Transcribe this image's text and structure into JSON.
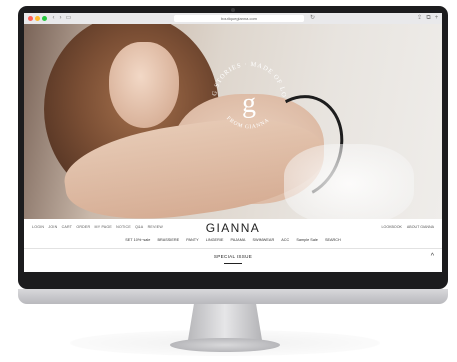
{
  "browser": {
    "url": "boutiquegianna.com"
  },
  "hero": {
    "logo_letter": "g",
    "logo_ring_text": "G STORIES · MADE OF LOVE",
    "logo_bottom_text": "FROM GIANNA"
  },
  "header": {
    "brand": "GIANNA",
    "top_links": [
      "LOGIN",
      "JOIN",
      "CART",
      "ORDER",
      "MY PAGE",
      "NOTICE",
      "Q&A",
      "REVIEW"
    ],
    "right_links": [
      "LOOKBOOK",
      "ABOUT GIANNA"
    ],
    "categories": [
      "SET 10%~sale",
      "BRASSIERE",
      "PANTY",
      "LINGERIE",
      "PAJAMA",
      "SWIMWEAR",
      "ACC",
      "Sample Sale",
      "SEARCH"
    ]
  },
  "section": {
    "title": "SPECIAL ISSUE",
    "caret": "^"
  },
  "colors": {
    "frame": "#1c1c1e",
    "accent_text": "#222222"
  }
}
